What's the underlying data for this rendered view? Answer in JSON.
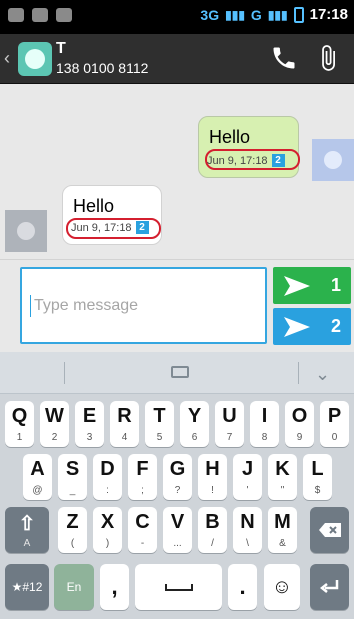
{
  "status_bar": {
    "network_1": "3G",
    "network_2": "G",
    "time": "17:18"
  },
  "header": {
    "contact_initial": "T",
    "contact_number": "138 0100 8112"
  },
  "messages": {
    "outgoing": {
      "text": "Hello",
      "time": "Jun 9, 17:18",
      "sim": "2"
    },
    "incoming": {
      "text": "Hello",
      "time": "Jun 9, 17:18",
      "sim": "2"
    }
  },
  "composer": {
    "placeholder": "Type message",
    "send_buttons": [
      {
        "label": "1",
        "color": "#2bb24c"
      },
      {
        "label": "2",
        "color": "#2aa1df"
      }
    ]
  },
  "keyboard": {
    "row1": [
      {
        "main": "Q",
        "sub": "1"
      },
      {
        "main": "W",
        "sub": "2"
      },
      {
        "main": "E",
        "sub": "3"
      },
      {
        "main": "R",
        "sub": "4"
      },
      {
        "main": "T",
        "sub": "5"
      },
      {
        "main": "Y",
        "sub": "6"
      },
      {
        "main": "U",
        "sub": "7"
      },
      {
        "main": "I",
        "sub": "8"
      },
      {
        "main": "O",
        "sub": "9"
      },
      {
        "main": "P",
        "sub": "0"
      }
    ],
    "row2": [
      {
        "main": "A",
        "sub": "@"
      },
      {
        "main": "S",
        "sub": "_"
      },
      {
        "main": "D",
        "sub": ":"
      },
      {
        "main": "F",
        "sub": ";"
      },
      {
        "main": "G",
        "sub": "?"
      },
      {
        "main": "H",
        "sub": "!"
      },
      {
        "main": "J",
        "sub": "'"
      },
      {
        "main": "K",
        "sub": "\""
      },
      {
        "main": "L",
        "sub": "$"
      }
    ],
    "row3": [
      {
        "main": "Z",
        "sub": "("
      },
      {
        "main": "X",
        "sub": ")"
      },
      {
        "main": "C",
        "sub": "-"
      },
      {
        "main": "V",
        "sub": "..."
      },
      {
        "main": "B",
        "sub": "/"
      },
      {
        "main": "N",
        "sub": "\\"
      },
      {
        "main": "M",
        "sub": "&"
      }
    ],
    "shift_label": "A",
    "symbols_label": "★#12",
    "language_label": "En",
    "comma_label": ",",
    "period_label": "."
  }
}
